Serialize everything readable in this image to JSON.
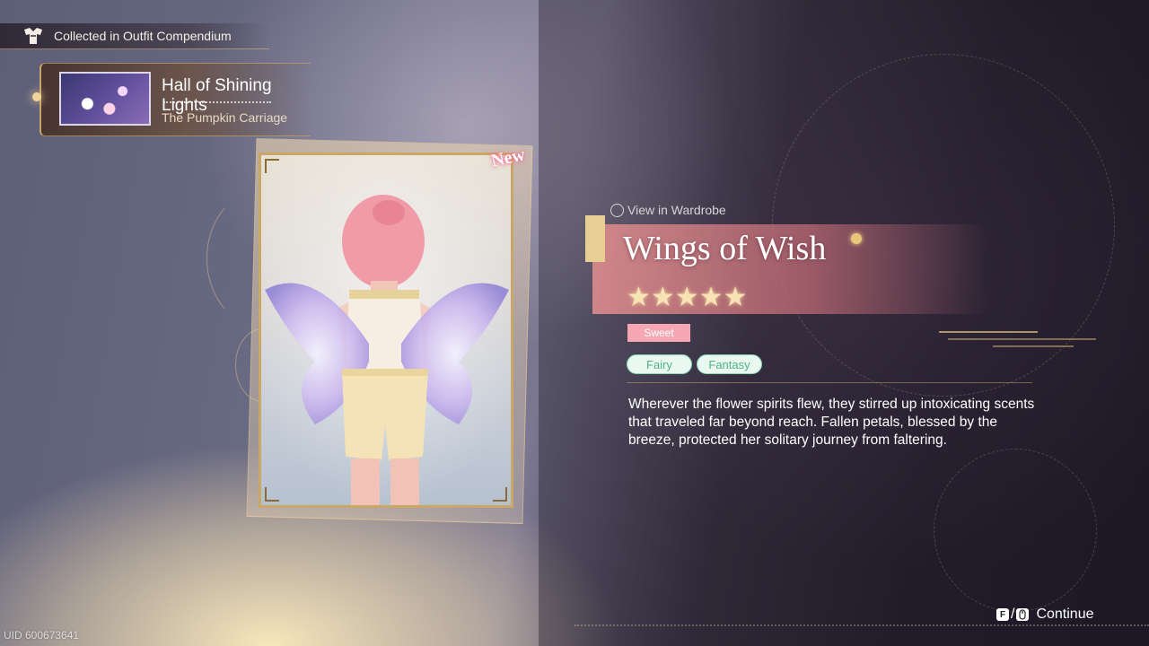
{
  "header": {
    "compendium_label": "Collected in Outfit Compendium",
    "compendium_icon": "outfit-compendium-icon"
  },
  "collection": {
    "title": "Hall of Shining Lights",
    "subtitle": "The Pumpkin Carriage"
  },
  "card": {
    "badge": "New"
  },
  "outfit": {
    "view_wardrobe_label": "View in Wardrobe",
    "name": "Wings of Wish",
    "stars": "★★★★★",
    "rarity": 5,
    "style_tag": "Sweet",
    "labels": [
      "Fairy",
      "Fantasy"
    ],
    "description": "Wherever the flower spirits flew, they stirred up intoxicating scents that traveled far beyond reach. Fallen petals, blessed by the breeze, protected her solitary journey from faltering."
  },
  "footer": {
    "uid": "UID 600673641",
    "continue_key": "F",
    "continue_separator": "/",
    "continue_label": "Continue"
  },
  "colors": {
    "gold": "#c9a867",
    "pink_band": "#dc8c8c",
    "sweet_tag": "#f7a7b4",
    "label_green": "#53b08d"
  }
}
